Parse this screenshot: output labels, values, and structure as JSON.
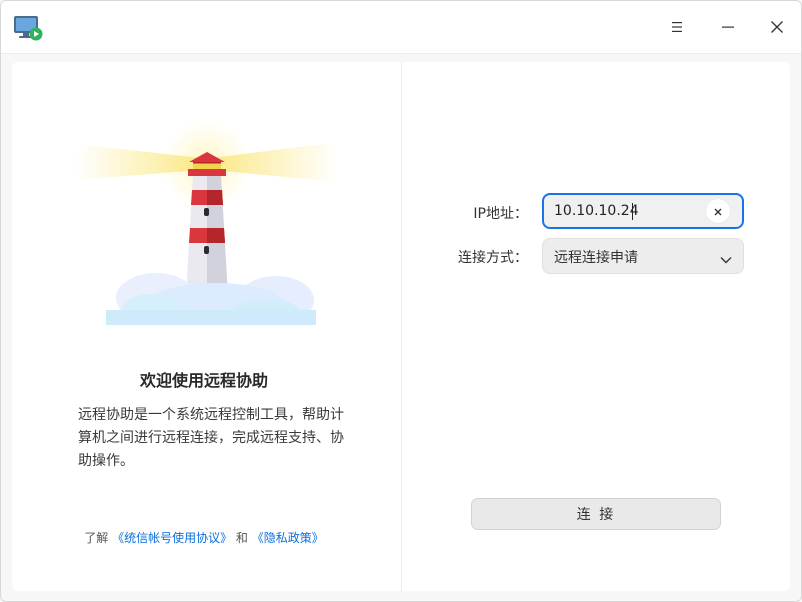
{
  "window": {
    "title_icon": "remote-desktop-icon",
    "controls": {
      "menu": "menu-icon",
      "minimize": "minimize-icon",
      "close": "close-icon"
    }
  },
  "welcome": {
    "title": "欢迎使用远程协助",
    "description": "远程协助是一个系统远程控制工具，帮助计算机之间进行远程连接，完成远程支持、协助操作。",
    "agreement_prefix": "了解",
    "agreement_link1": "《统信帐号使用协议》",
    "agreement_middle": "和",
    "agreement_link2": "《隐私政策》"
  },
  "form": {
    "ip_label": "IP地址：",
    "ip_value": "10.10.10.24",
    "mode_label": "连接方式：",
    "mode_value": "远程连接申请",
    "connect_label": "连 接"
  },
  "colors": {
    "accent": "#1a72e8",
    "link": "#0a6fdb",
    "lighthouse_red": "#d9363e"
  }
}
